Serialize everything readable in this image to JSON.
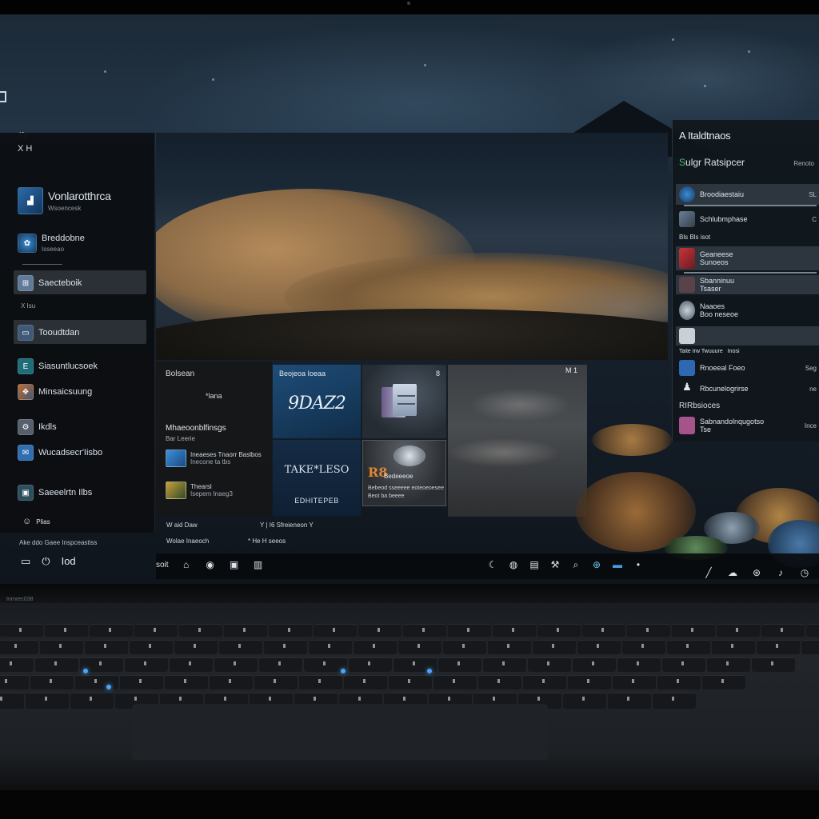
{
  "desktop": {
    "corner_label": "ifn",
    "photo_window_corner": "M 1",
    "hero_alt": "desert dune wallpaper"
  },
  "start_panel": {
    "header": "X H",
    "items": [
      {
        "label": "Vonlarotthrca",
        "sub": "Wsoencesk",
        "icon": "app-icon"
      },
      {
        "label": "Breddobne",
        "sub": "Isseeao",
        "icon": "globe-icon"
      },
      {
        "label": "Saecteboik",
        "icon": "photos-icon",
        "selected": true
      },
      {
        "label": "Tooudtdan",
        "icon": "folder-icon",
        "selected": true
      },
      {
        "label": "Siasuntlucsoek",
        "icon": "terminal-icon"
      },
      {
        "label": "Minsaicsuung",
        "icon": "game-icon"
      },
      {
        "label": "Ikdls",
        "icon": "settings-icon"
      },
      {
        "label": "Wucadsecr'Iisbo",
        "icon": "mail-icon"
      },
      {
        "label": "Saeeelrtn Ilbs",
        "icon": "monitor-icon"
      },
      {
        "label": "Plias",
        "icon": "user-icon"
      }
    ],
    "middle_mini": "X  Isu",
    "bottom_text": "Ake ddo Gaee Inspceastiss",
    "bottom_icons": [
      "folder-icon",
      "power-icon",
      "user-icon"
    ],
    "bottom_label": "Iod"
  },
  "lower_left_panel": {
    "title": "Bolsean",
    "mid": "*lana",
    "heading": "Mhaeoonblfinsgs",
    "sub": "Bar Leerie",
    "rows": [
      {
        "label": "Ineaeses Tnaorr Baslbos",
        "sub": "Inecone ta  tbs",
        "icon": "photo-icon"
      },
      {
        "label": "Thearsl",
        "sub": "Isepem Inaeg3",
        "icon": "game-icon"
      }
    ]
  },
  "tiles": {
    "blue1": {
      "title": "Beojeoa Ioeaa",
      "value": "9DAZ2"
    },
    "dark1": {
      "corner": "8",
      "icon": "files-icon"
    },
    "blue2": {
      "middle": "TAKE*LESO",
      "footer": "EDHITEPEB"
    },
    "dark2": {
      "badge": "R8",
      "caption": "Bedeeeoe",
      "line1": "Bebeod sseeeee  eoteoeoesee",
      "line2": "Beot ba  beeee"
    }
  },
  "right_panel": {
    "title": "A Italdtnaos",
    "subtitle_prefix": "S",
    "subtitle": "ulgr Ratsipcer",
    "close_label": "Renoto",
    "rows": [
      {
        "label": "Broodiaestaiu",
        "value": "SL",
        "icon": "browser-icon",
        "highlighted": true
      },
      {
        "label": "Schlubmphase",
        "value": "C",
        "icon": "photo-icon"
      },
      {
        "label": "Geaneese",
        "sub": "Sunoeos",
        "icon": "calendar-icon",
        "highlighted": true
      },
      {
        "label": "Sbanninuu",
        "sub": "Tsaser",
        "icon": "mail-icon",
        "highlighted": true
      },
      {
        "label": "Naaoes",
        "sub": "Boo neseoe",
        "icon": "globe-icon"
      },
      {
        "label": "Taite  Irw Twuuure",
        "sub": "Inosi",
        "icon": "photo-icon",
        "highlighted": true
      },
      {
        "label": "Rnoeeal Foeo",
        "value": "Seg",
        "icon": "settings-icon"
      },
      {
        "label": "Rbcunelogrirse",
        "value": "ne",
        "icon": "user-icon"
      },
      {
        "label": "Sabnandolnqugotso",
        "sub": "Tse",
        "value": "Ince",
        "icon": "app-icon"
      }
    ],
    "section_1": "Bls Bls  isot",
    "section_2": "RIRbsioces"
  },
  "status_rows": [
    {
      "left": "W  aid Daw",
      "right": "Y | I6  Sfreieneon Y"
    },
    {
      "left": "Wolae Inaeoch",
      "right": "*  He  H  seeos"
    }
  ],
  "taskbar": {
    "start_label": "soit",
    "left_icons": [
      "store-icon",
      "edge-icon",
      "mail-icon",
      "files-icon"
    ],
    "mid_icons": [
      "moon-icon",
      "browser-icon",
      "file-icon",
      "tool-icon",
      "search-icon",
      "globe-icon",
      "store-icon",
      "dot-icon"
    ],
    "tray_icons": [
      "pen-icon",
      "cloud-icon",
      "network-icon",
      "speaker-icon",
      "clock-icon"
    ]
  },
  "laptop": {
    "brand": "Inrnrec038"
  }
}
